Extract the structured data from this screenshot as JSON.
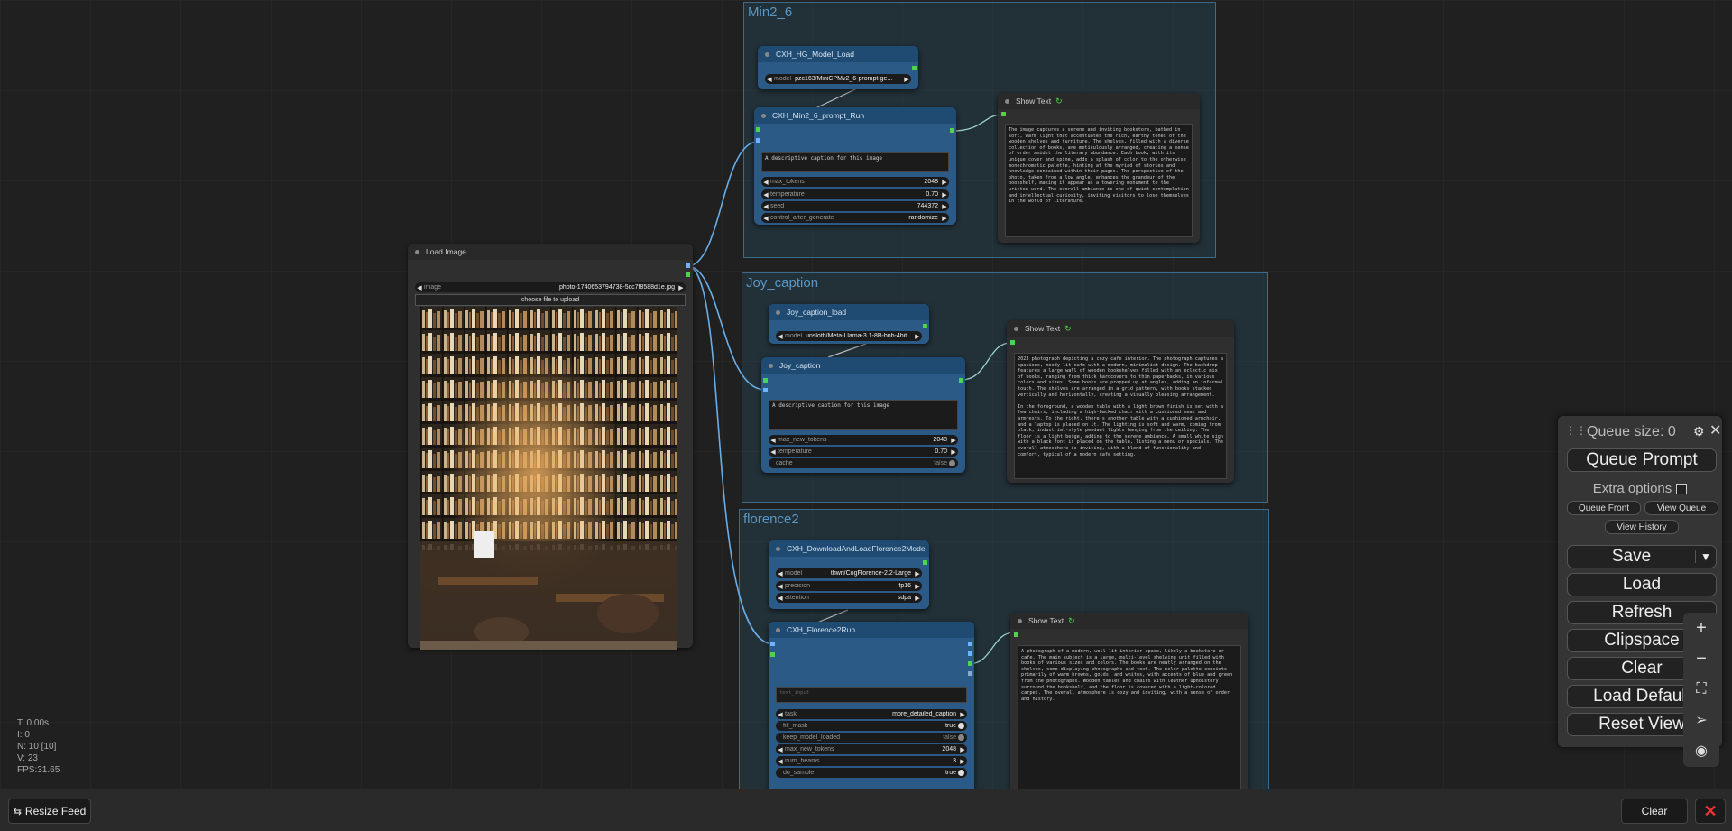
{
  "stats": {
    "t": "T: 0.00s",
    "i": "I: 0",
    "n": "N: 10 [10]",
    "v": "V: 23",
    "fps": "FPS:31.65"
  },
  "groups": {
    "g1": "Min2_6",
    "g2": "Joy_caption",
    "g3": "florence2"
  },
  "load_image": {
    "title": "Load Image",
    "image_label": "image",
    "image_value": "photo-1740653794738-5cc7f8588d1e.jpg",
    "upload_label": "choose file to upload"
  },
  "hg_load": {
    "title": "CXH_HG_Model_Load",
    "model_label": "model",
    "model_value": "pzc163/MiniCPMv2_6-prompt-ge..."
  },
  "min_run": {
    "title": "CXH_Min2_6_prompt_Run",
    "prompt": "A descriptive caption for this image",
    "widgets": [
      {
        "label": "max_tokens",
        "value": "2048"
      },
      {
        "label": "temperature",
        "value": "0.70"
      },
      {
        "label": "seed",
        "value": "744372"
      },
      {
        "label": "control_after_generate",
        "value": "randomize"
      }
    ]
  },
  "show1": {
    "title": "Show Text",
    "text": "The image captures a serene and inviting bookstore, bathed in soft, warm light that accentuates the rich, earthy tones of the wooden shelves and furniture. The shelves, filled with a diverse collection of books, are meticulously arranged, creating a sense of order amidst the literary abundance. Each book, with its unique cover and spine, adds a splash of color to the otherwise monochromatic palette, hinting at the myriad of stories and knowledge contained within their pages. The perspective of the photo, taken from a low angle, enhances the grandeur of the bookshelf, making it appear as a towering monument to the written word. The overall ambiance is one of quiet contemplation and intellectual curiosity, inviting visitors to lose themselves in the world of literature."
  },
  "joy_load": {
    "title": "Joy_caption_load",
    "model_label": "model",
    "model_value": "unsloth/Meta-Llama-3.1-8B-bnb-4bit"
  },
  "joy": {
    "title": "Joy_caption",
    "prompt": "A descriptive caption for this image",
    "widgets": [
      {
        "label": "max_new_tokens",
        "value": "2048"
      },
      {
        "label": "temperature",
        "value": "0.70"
      },
      {
        "label": "cache",
        "value": "false"
      }
    ]
  },
  "show2": {
    "title": "Show Text",
    "text": "2023 photograph depicting a cozy cafe interior. The photograph captures a spacious, moody lit cafe with a modern, minimalist design. The backdrop features a large wall of wooden bookshelves filled with an eclectic mix of books, ranging from thick hardcovers to thin paperbacks, in various colors and sizes. Some books are propped up at angles, adding an informal touch. The shelves are arranged in a grid pattern, with books stacked vertically and horizontally, creating a visually pleasing arrangement.\n\nIn the foreground, a wooden table with a light brown finish is set with a few chairs, including a high-backed chair with a cushioned seat and armrests. To the right, there's another table with a cushioned armchair, and a laptop is placed on it. The lighting is soft and warm, coming from black, industrial-style pendant lights hanging from the ceiling. The floor is a light beige, adding to the serene ambiance. A small white sign with a black font is placed on the table, listing a menu or specials. The overall atmosphere is inviting, with a blend of functionality and comfort, typical of a modern cafe setting."
  },
  "flor_load": {
    "title": "CXH_DownloadAndLoadFlorence2Model",
    "widgets": [
      {
        "label": "model",
        "value": "thwri/CogFlorence-2.2-Large"
      },
      {
        "label": "precision",
        "value": "fp16"
      },
      {
        "label": "attention",
        "value": "sdpa"
      }
    ]
  },
  "flor_run": {
    "title": "CXH_Florence2Run",
    "placeholder": "text_input",
    "widgets": [
      {
        "label": "task",
        "value": "more_detailed_caption"
      },
      {
        "label": "fill_mask",
        "value": "true"
      },
      {
        "label": "keep_model_loaded",
        "value": "false"
      },
      {
        "label": "max_new_tokens",
        "value": "2048"
      },
      {
        "label": "num_beams",
        "value": "3"
      },
      {
        "label": "do_sample",
        "value": "true"
      }
    ]
  },
  "show3": {
    "title": "Show Text",
    "text": "A photograph of a modern, well-lit interior space, likely a bookstore or cafe. The main subject is a large, multi-level shelving unit filled with books of various sizes and colors. The books are neatly arranged on the shelves, some displaying photographs and text. The color palette consists primarily of warm browns, golds, and whites, with accents of blue and green from the photographs. Wooden tables and chairs with leather upholstery surround the bookshelf, and the floor is covered with a light-colored carpet. The overall atmosphere is cozy and inviting, with a sense of order and history."
  },
  "menu": {
    "queue_size": "Queue size: 0",
    "queue_prompt": "Queue Prompt",
    "extra_options": "Extra options",
    "queue_front": "Queue Front",
    "view_queue": "View Queue",
    "view_history": "View History",
    "save": "Save",
    "load": "Load",
    "refresh": "Refresh",
    "clipspace": "Clipspace",
    "clear": "Clear",
    "load_default": "Load Default",
    "reset_view": "Reset View"
  },
  "bottombar": {
    "resize_feed": "Resize Feed",
    "clear": "Clear"
  }
}
